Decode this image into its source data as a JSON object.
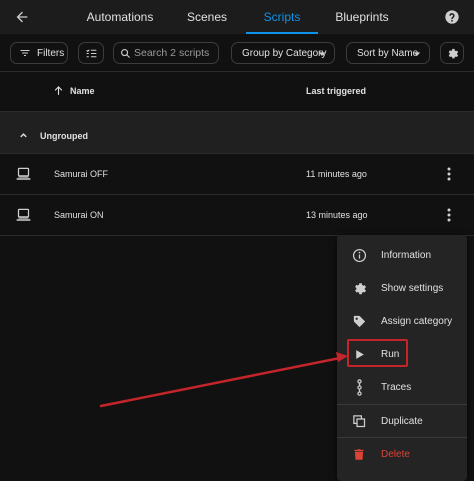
{
  "tabs": [
    {
      "label": "Automations",
      "active": false
    },
    {
      "label": "Scenes",
      "active": false
    },
    {
      "label": "Scripts",
      "active": true
    },
    {
      "label": "Blueprints",
      "active": false
    }
  ],
  "toolbar": {
    "filters_label": "Filters",
    "search_placeholder": "Search 2 scripts",
    "group_label": "Group by Category",
    "sort_label": "Sort by Name"
  },
  "table": {
    "col_name": "Name",
    "col_last_triggered": "Last triggered",
    "group_label": "Ungrouped",
    "rows": [
      {
        "name": "Samurai OFF",
        "last_triggered": "11 minutes ago"
      },
      {
        "name": "Samurai ON",
        "last_triggered": "13 minutes ago"
      }
    ]
  },
  "menu": {
    "items": [
      {
        "label": "Information",
        "icon": "information-icon"
      },
      {
        "label": "Show settings",
        "icon": "gear-icon"
      },
      {
        "label": "Assign category",
        "icon": "tag-icon"
      },
      {
        "label": "Run",
        "icon": "play-icon"
      },
      {
        "label": "Traces",
        "icon": "traces-icon"
      },
      {
        "label": "Duplicate",
        "icon": "duplicate-icon"
      },
      {
        "label": "Delete",
        "icon": "trash-icon"
      }
    ]
  },
  "colors": {
    "accent": "#0f93e8",
    "danger": "#db4437",
    "annotation": "#c4252a",
    "background": "#111111"
  }
}
